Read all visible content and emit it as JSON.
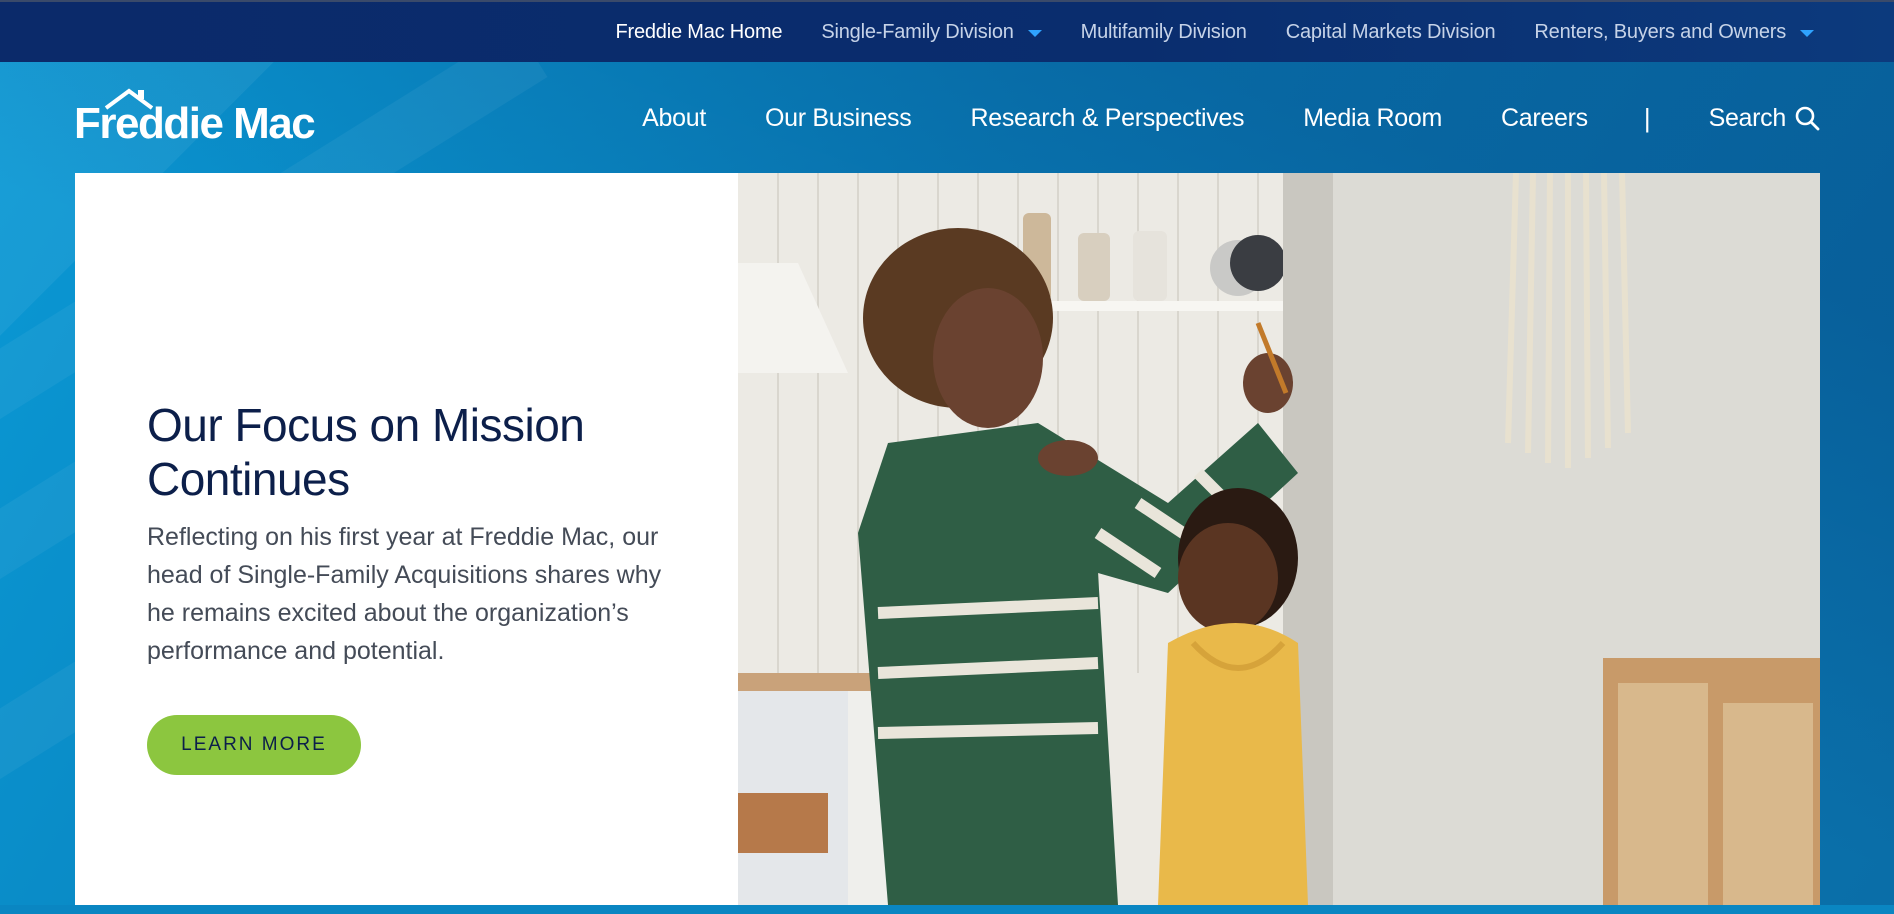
{
  "top_nav": {
    "items": [
      {
        "label": "Freddie Mac Home",
        "active": true,
        "dropdown": false
      },
      {
        "label": "Single-Family Division",
        "active": false,
        "dropdown": true
      },
      {
        "label": "Multifamily Division",
        "active": false,
        "dropdown": false
      },
      {
        "label": "Capital Markets Division",
        "active": false,
        "dropdown": false
      },
      {
        "label": "Renters, Buyers and Owners",
        "active": false,
        "dropdown": true
      }
    ]
  },
  "logo": {
    "text": "Freddie Mac"
  },
  "main_nav": {
    "items": [
      "About",
      "Our Business",
      "Research & Perspectives",
      "Media Room",
      "Careers"
    ],
    "separator": "|",
    "search_label": "Search"
  },
  "hero": {
    "title": "Our Focus on Mission Continues",
    "body": "Reflecting on his first year at Freddie Mac, our head of Single-Family Acquisitions shares why he remains excited about the organization’s performance and potential.",
    "button_label": "LEARN MORE"
  },
  "colors": {
    "top_bar": "#0b2a6a",
    "header_bg": "#0a86c2",
    "accent_green": "#8cc63f",
    "title_navy": "#0c1f4a",
    "caret_blue": "#2fa3ff"
  },
  "icons": {
    "search": "magnifier-icon",
    "dropdown": "caret-down-icon",
    "logo_roof": "house-roof-icon"
  }
}
